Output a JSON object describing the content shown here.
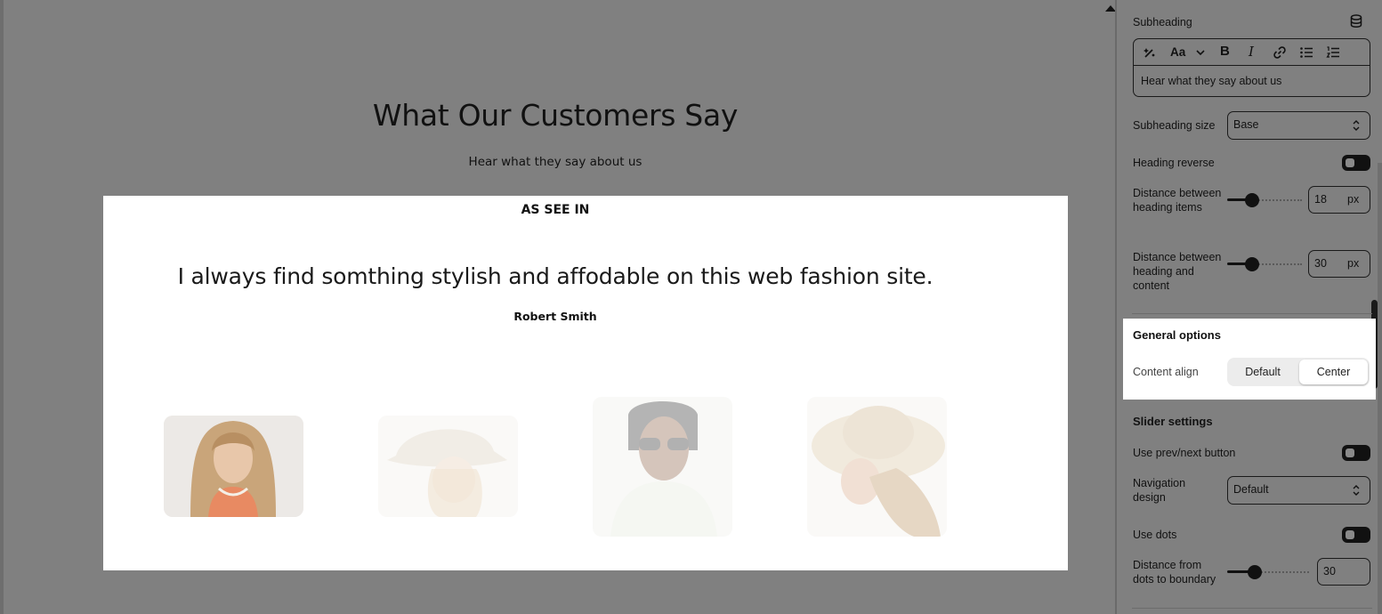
{
  "preview": {
    "title": "What Our Customers Say",
    "subtitle": "Hear what they say about us",
    "card": {
      "label": "AS SEE IN",
      "quote": "I always find somthing stylish and affodable on this web fashion site.",
      "author": "Robert Smith"
    }
  },
  "sidebar": {
    "subheading": {
      "label": "Subheading",
      "toolbar_font": "Aa",
      "value": "Hear what they say about us"
    },
    "subheading_size": {
      "label": "Subheading size",
      "value": "Base"
    },
    "heading_reverse": {
      "label": "Heading reverse",
      "on": false
    },
    "distance_heading_items": {
      "label": "Distance between heading items",
      "value": "18",
      "unit": "px"
    },
    "distance_heading_content": {
      "label": "Distance between heading and content",
      "value": "30",
      "unit": "px"
    },
    "general_options": {
      "title": "General options",
      "content_align_label": "Content align",
      "options": [
        "Default",
        "Center"
      ],
      "selected": "Center"
    },
    "slider_settings": {
      "title": "Slider settings",
      "use_prev_next": {
        "label": "Use prev/next button",
        "on": false
      },
      "navigation_design": {
        "label": "Navigation design",
        "value": "Default"
      },
      "use_dots": {
        "label": "Use dots",
        "on": false
      },
      "dots_distance": {
        "label": "Distance from dots to boundary",
        "value": "30"
      }
    }
  },
  "colors": {
    "overlay": "#808080",
    "card": "#ffffff",
    "accent": "#111111"
  }
}
